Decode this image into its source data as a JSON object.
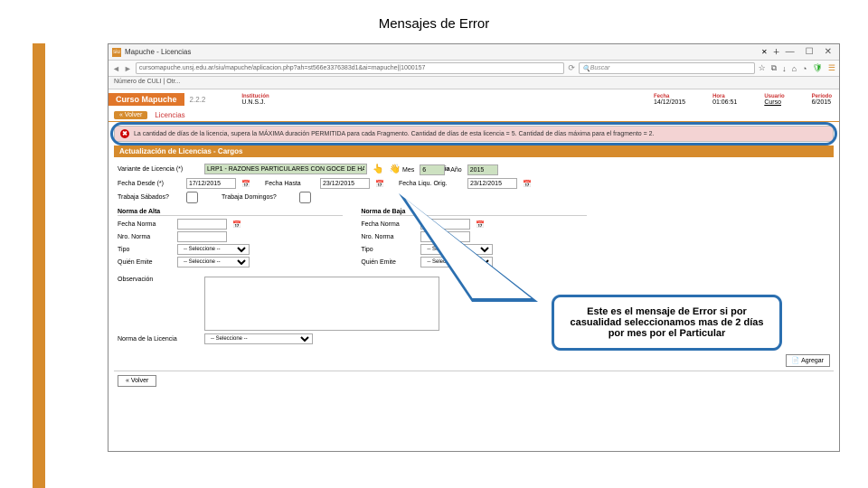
{
  "title": "Mensajes de Error",
  "browser": {
    "tab": "Mapuche - Licencias",
    "windowControls": {
      "min": "—",
      "max": "☐",
      "close": "✕"
    },
    "url": "cursomapuche.unsj.edu.ar/siu/mapuche/aplicacion.php?ah=st566e3376383d1&ai=mapuche||1000157",
    "search_placeholder": "Buscar",
    "secondBar": "Número de CULI | Otr..."
  },
  "topbar": {
    "brand": "Curso Mapuche",
    "version": "2.2.2",
    "inst_k": "Institución",
    "inst_v": "U.N.S.J.",
    "fecha_k": "Fecha",
    "fecha_v": "14/12/2015",
    "hora_k": "Hora",
    "hora_v": "01:06:51",
    "usuario_k": "Usuario",
    "usuario_v": "Curso",
    "periodo_k": "Período",
    "periodo_v": "6/2015"
  },
  "crumb": {
    "volver": "« Volver",
    "label": "Licencias"
  },
  "error": "La cantidad de días de la licencia, supera la MÁXIMA duración PERMITIDA para cada Fragmento. Cantidad de días de esta licencia = 5. Cantidad de días máxima para el fragmento = 2.",
  "section": "Actualización de Licencias - Cargos",
  "form": {
    "variante_lbl": "Variante de Licencia (*)",
    "variante_val": "LRP1 - RAZONES PARTICULARES CON GOCE DE HA",
    "vig_lbl": "Vigencia",
    "mes_lbl": "Mes",
    "mes_val": "6",
    "anio_lbl": "Año",
    "anio_val": "2015",
    "desde_lbl": "Fecha Desde (*)",
    "desde_val": "17/12/2015",
    "hasta_lbl": "Fecha Hasta",
    "hasta_val": "23/12/2015",
    "ult_lbl": "Fecha Liqu. Orig.",
    "ult_val": "23/12/2015",
    "sab_lbl": "Trabaja Sábados?",
    "dom_lbl": "Trabaja Domingos?",
    "alta_hdr": "Norma de Alta",
    "baja_hdr": "Norma de Baja",
    "fnorma": "Fecha Norma",
    "nnorma": "Nro. Norma",
    "tipo": "Tipo",
    "emisor": "Quién Emite",
    "sel_placeholder": "-- Seleccione --",
    "obs_lbl": "Observación",
    "nlic_lbl": "Norma de la Licencia",
    "agregar": "📄 Agregar",
    "volver2": "« Volver"
  },
  "callout": "Este es el mensaje de Error si por casualidad seleccionamos mas de 2 días por mes por el Particular"
}
